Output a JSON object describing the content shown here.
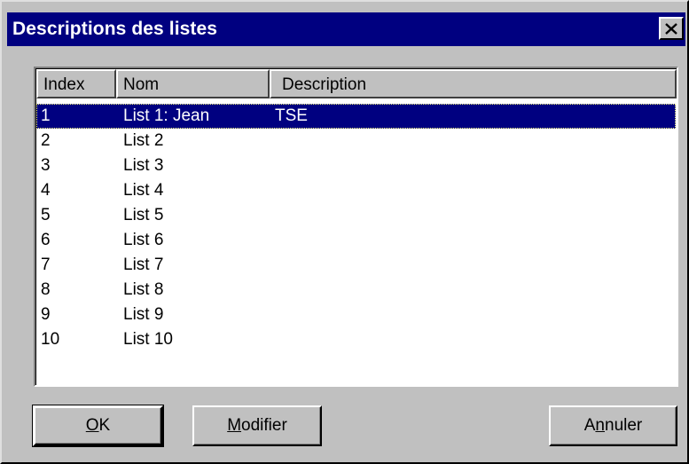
{
  "dialog": {
    "title": "Descriptions des listes",
    "close_icon": "close-x-icon"
  },
  "list": {
    "columns": [
      "Index",
      "Nom",
      "Description"
    ],
    "rows": [
      {
        "index": "1",
        "nom": "List 1: Jean",
        "description": "TSE",
        "selected": true
      },
      {
        "index": "2",
        "nom": "List 2",
        "description": ""
      },
      {
        "index": "3",
        "nom": "List 3",
        "description": ""
      },
      {
        "index": "4",
        "nom": "List 4",
        "description": ""
      },
      {
        "index": "5",
        "nom": "List 5",
        "description": ""
      },
      {
        "index": "6",
        "nom": "List 6",
        "description": ""
      },
      {
        "index": "7",
        "nom": "List 7",
        "description": ""
      },
      {
        "index": "8",
        "nom": "List 8",
        "description": ""
      },
      {
        "index": "9",
        "nom": "List 9",
        "description": ""
      },
      {
        "index": "10",
        "nom": "List 10",
        "description": ""
      }
    ]
  },
  "buttons": {
    "ok": {
      "mnemonic": "O",
      "rest": "K"
    },
    "modifier": {
      "mnemonic": "M",
      "rest": "odifier"
    },
    "annuler": {
      "pre": "A",
      "mnemonic": "n",
      "rest": "nuler"
    }
  },
  "colors": {
    "titlebar": "#000080",
    "selection": "#000080",
    "face": "#c0c0c0"
  }
}
